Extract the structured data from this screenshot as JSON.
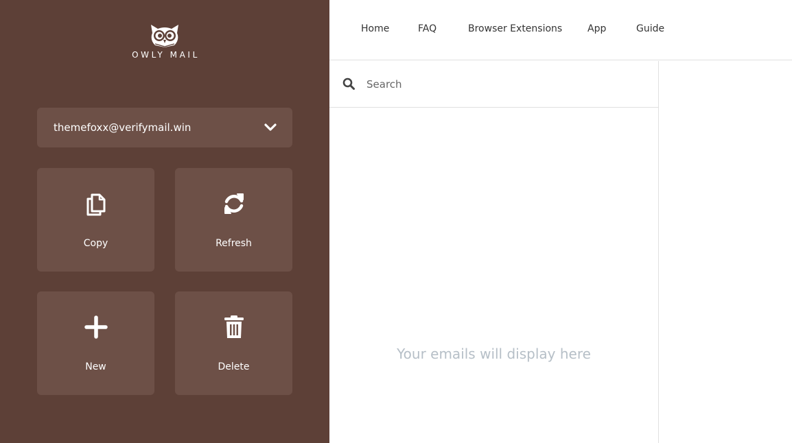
{
  "brand": {
    "name": "OWLY MAIL",
    "logo_icon": "owl-icon"
  },
  "colors": {
    "sidebar_bg": "#5d4037",
    "tile_bg": "#6d5047",
    "placeholder_text": "#b6bfc7"
  },
  "email_selector": {
    "value": "themefoxx@verifymail.win",
    "icon": "chevron-down-icon"
  },
  "actions": [
    {
      "label": "Copy",
      "icon": "copy-icon"
    },
    {
      "label": "Refresh",
      "icon": "refresh-icon"
    },
    {
      "label": "New",
      "icon": "plus-icon"
    },
    {
      "label": "Delete",
      "icon": "trash-icon"
    }
  ],
  "nav": {
    "items": [
      "Home",
      "FAQ",
      "Browser Extensions",
      "App",
      "Guide"
    ]
  },
  "search": {
    "placeholder": "Search",
    "icon": "search-icon"
  },
  "inbox": {
    "empty_message": "Your emails will display here"
  }
}
